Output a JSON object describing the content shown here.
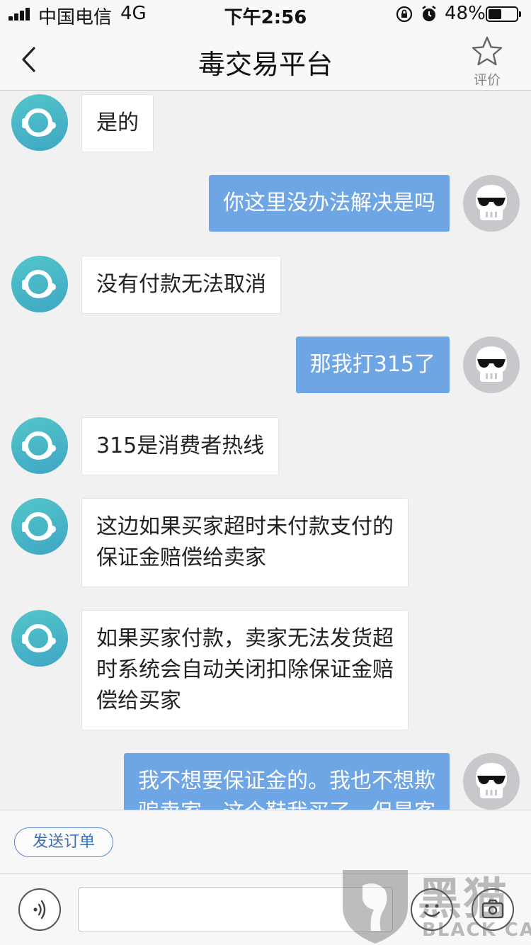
{
  "status_bar": {
    "carrier": "中国电信",
    "network": "4G",
    "time": "下午2:56",
    "battery": "48%",
    "battery_level": 0.48
  },
  "nav": {
    "title": "毒交易平台",
    "rate_label": "评价",
    "icons": {
      "back": "chevron-left-icon",
      "rate": "star-icon"
    }
  },
  "colors": {
    "user_bubble": "#6ea5e4",
    "agent_bubble": "#ffffff",
    "agent_avatar": "#4bb8c7",
    "background": "#f1f1f2",
    "link_blue": "#3e6fb5"
  },
  "messages": [
    {
      "sender": "agent",
      "lines": [
        "是的"
      ]
    },
    {
      "sender": "user",
      "lines": [
        "你这里没办法解决是吗"
      ]
    },
    {
      "sender": "agent",
      "lines": [
        "没有付款无法取消"
      ]
    },
    {
      "sender": "user",
      "lines": [
        "那我打315了"
      ]
    },
    {
      "sender": "agent",
      "lines": [
        "315是消费者热线"
      ]
    },
    {
      "sender": "agent",
      "lines": [
        "这边如果买家超时未付款支付的",
        "保证金赔偿给卖家"
      ]
    },
    {
      "sender": "agent",
      "lines": [
        "如果买家付款，卖家无法发货超",
        "时系统会自动关闭扣除保证金赔",
        "偿给买家"
      ]
    },
    {
      "sender": "user",
      "lines": [
        "我不想要保证金的。我也不想欺",
        "骗卖家，这个鞋我买了，但是客"
      ]
    }
  ],
  "footer": {
    "send_order_label": "发送订单",
    "message_placeholder": "",
    "icons": {
      "voice": "voice-icon",
      "emoji": "emoji-icon",
      "camera": "camera-icon"
    }
  },
  "watermark": {
    "cn": "黑猫",
    "en": "BLACK CAT"
  }
}
